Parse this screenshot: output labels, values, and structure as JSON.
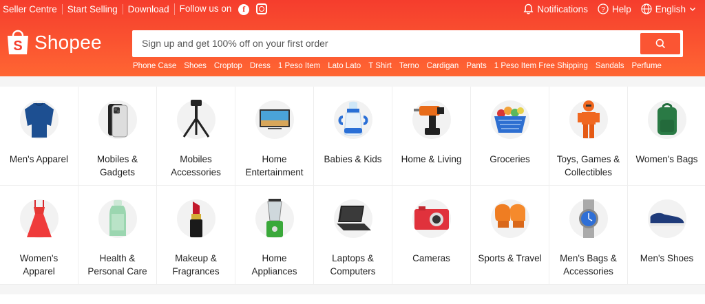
{
  "topbar": {
    "left_links": [
      "Seller Centre",
      "Start Selling",
      "Download"
    ],
    "follow_label": "Follow us on",
    "social_icons": [
      "facebook-icon",
      "instagram-icon"
    ],
    "notifications_label": "Notifications",
    "help_label": "Help",
    "language_label": "English"
  },
  "brand": {
    "name": "Shopee",
    "logo_glyph": "S"
  },
  "search": {
    "placeholder": "Sign up and get 100% off on your first order"
  },
  "keywords": [
    "Phone Case",
    "Shoes",
    "Croptop",
    "Dress",
    "1 Peso Item",
    "Lato Lato",
    "T Shirt",
    "Terno",
    "Cardigan",
    "Pants",
    "1 Peso Item Free Shipping",
    "Sandals",
    "Perfume"
  ],
  "categories": [
    {
      "label": "Men's Apparel",
      "icon": "sweater-icon"
    },
    {
      "label": "Mobiles & Gadgets",
      "icon": "smartphone-icon"
    },
    {
      "label": "Mobiles Accessories",
      "icon": "tripod-icon"
    },
    {
      "label": "Home Entertainment",
      "icon": "tv-icon"
    },
    {
      "label": "Babies & Kids",
      "icon": "baby-bottle-icon"
    },
    {
      "label": "Home & Living",
      "icon": "drill-icon"
    },
    {
      "label": "Groceries",
      "icon": "grocery-basket-icon"
    },
    {
      "label": "Toys, Games & Collectibles",
      "icon": "toy-figure-icon"
    },
    {
      "label": "Women's Bags",
      "icon": "backpack-icon"
    },
    {
      "label": "Women's Apparel",
      "icon": "dress-icon"
    },
    {
      "label": "Health & Personal Care",
      "icon": "lotion-bottle-icon"
    },
    {
      "label": "Makeup & Fragrances",
      "icon": "lipstick-icon"
    },
    {
      "label": "Home Appliances",
      "icon": "blender-icon"
    },
    {
      "label": "Laptops & Computers",
      "icon": "laptop-icon"
    },
    {
      "label": "Cameras",
      "icon": "camera-icon"
    },
    {
      "label": "Sports & Travel",
      "icon": "boxing-glove-icon"
    },
    {
      "label": "Men's Bags & Accessories",
      "icon": "watch-icon"
    },
    {
      "label": "Men's Shoes",
      "icon": "shoe-icon"
    }
  ],
  "colors": {
    "brand": "#ee4d2d",
    "search_button": "#fb5533"
  }
}
